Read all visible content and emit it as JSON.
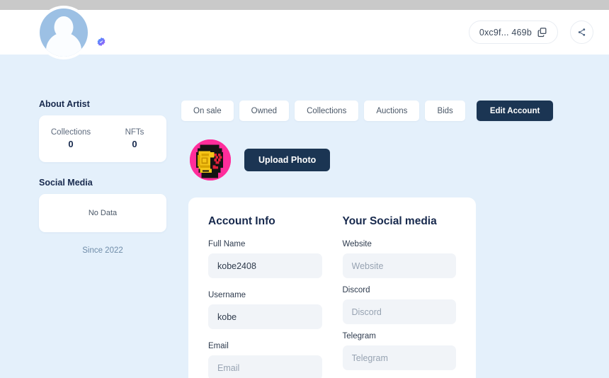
{
  "header": {
    "avatar_icon": "user-avatar-placeholder-icon",
    "verified_badge_icon": "verified-check-icon",
    "address": "0xc9f... 469b",
    "copy_icon": "copy-icon",
    "share_icon": "share-icon"
  },
  "sidebar": {
    "about_heading": "About Artist",
    "stats": [
      {
        "label": "Collections",
        "value": "0"
      },
      {
        "label": "NFTs",
        "value": "0"
      }
    ],
    "social_heading": "Social Media",
    "social_empty": "No Data",
    "since": "Since 2022"
  },
  "tabs": [
    {
      "label": "On sale",
      "name": "tab-on-sale",
      "active": false
    },
    {
      "label": "Owned",
      "name": "tab-owned",
      "active": false
    },
    {
      "label": "Collections",
      "name": "tab-collections",
      "active": false
    },
    {
      "label": "Auctions",
      "name": "tab-auctions",
      "active": false
    },
    {
      "label": "Bids",
      "name": "tab-bids",
      "active": false
    },
    {
      "label": "Edit Account",
      "name": "tab-edit-account",
      "active": true
    }
  ],
  "photo_row": {
    "nft_avatar_icon": "pixel-helmet-nft-avatar-icon",
    "upload_label": "Upload Photo"
  },
  "form": {
    "account_info": {
      "title": "Account Info",
      "fields": [
        {
          "label": "Full Name",
          "value": "kobe2408",
          "placeholder": "Full Name"
        },
        {
          "label": "Username",
          "value": "kobe",
          "placeholder": "Username"
        },
        {
          "label": "Email",
          "value": "",
          "placeholder": "Email"
        }
      ]
    },
    "social": {
      "title": "Your Social media",
      "fields": [
        {
          "label": "Website",
          "value": "",
          "placeholder": "Website"
        },
        {
          "label": "Discord",
          "value": "",
          "placeholder": "Discord"
        },
        {
          "label": "Telegram",
          "value": "",
          "placeholder": "Telegram"
        }
      ]
    }
  },
  "colors": {
    "page_background": "#e4f0fb",
    "accent_dark": "#1b3553",
    "card_white": "#ffffff",
    "input_fill": "#f1f4f8",
    "nft_pink": "#ff2d9b",
    "nft_gold": "#f5c518"
  }
}
